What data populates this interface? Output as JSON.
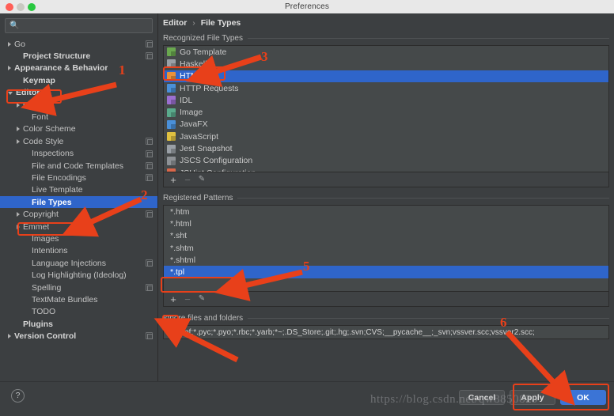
{
  "window": {
    "title": "Preferences",
    "traffic_lights": [
      "close-red",
      "minimize-yellow",
      "zoom-green"
    ]
  },
  "sidebar": {
    "search": {
      "value": "",
      "placeholder": "",
      "icon": "search-icon"
    },
    "items": [
      {
        "label": "Go",
        "arrow": "right",
        "indent": 0,
        "bold": false,
        "badge": true,
        "selected": false
      },
      {
        "label": "Project Structure",
        "arrow": "none",
        "indent": 1,
        "bold": true,
        "badge": true,
        "selected": false
      },
      {
        "label": "Appearance & Behavior",
        "arrow": "right",
        "indent": 0,
        "bold": true,
        "badge": false,
        "selected": false
      },
      {
        "label": "Keymap",
        "arrow": "none",
        "indent": 1,
        "bold": true,
        "badge": false,
        "selected": false
      },
      {
        "label": "Editor",
        "arrow": "down",
        "indent": 0,
        "bold": true,
        "badge": false,
        "selected": false
      },
      {
        "label": "General",
        "arrow": "right",
        "indent": 1,
        "bold": false,
        "badge": false,
        "selected": false
      },
      {
        "label": "Font",
        "arrow": "none",
        "indent": 2,
        "bold": false,
        "badge": false,
        "selected": false
      },
      {
        "label": "Color Scheme",
        "arrow": "right",
        "indent": 1,
        "bold": false,
        "badge": false,
        "selected": false
      },
      {
        "label": "Code Style",
        "arrow": "right",
        "indent": 1,
        "bold": false,
        "badge": true,
        "selected": false
      },
      {
        "label": "Inspections",
        "arrow": "none",
        "indent": 2,
        "bold": false,
        "badge": true,
        "selected": false
      },
      {
        "label": "File and Code Templates",
        "arrow": "none",
        "indent": 2,
        "bold": false,
        "badge": true,
        "selected": false
      },
      {
        "label": "File Encodings",
        "arrow": "none",
        "indent": 2,
        "bold": false,
        "badge": true,
        "selected": false
      },
      {
        "label": "Live Template",
        "arrow": "none",
        "indent": 2,
        "bold": false,
        "badge": false,
        "selected": false
      },
      {
        "label": "File Types",
        "arrow": "none",
        "indent": 2,
        "bold": true,
        "badge": false,
        "selected": true
      },
      {
        "label": "Copyright",
        "arrow": "right",
        "indent": 1,
        "bold": false,
        "badge": true,
        "selected": false
      },
      {
        "label": "Emmet",
        "arrow": "right",
        "indent": 1,
        "bold": false,
        "badge": false,
        "selected": false
      },
      {
        "label": "Images",
        "arrow": "none",
        "indent": 2,
        "bold": false,
        "badge": false,
        "selected": false
      },
      {
        "label": "Intentions",
        "arrow": "none",
        "indent": 2,
        "bold": false,
        "badge": false,
        "selected": false
      },
      {
        "label": "Language Injections",
        "arrow": "none",
        "indent": 2,
        "bold": false,
        "badge": true,
        "selected": false
      },
      {
        "label": "Log Highlighting (Ideolog)",
        "arrow": "none",
        "indent": 2,
        "bold": false,
        "badge": false,
        "selected": false
      },
      {
        "label": "Spelling",
        "arrow": "none",
        "indent": 2,
        "bold": false,
        "badge": true,
        "selected": false
      },
      {
        "label": "TextMate Bundles",
        "arrow": "none",
        "indent": 2,
        "bold": false,
        "badge": false,
        "selected": false
      },
      {
        "label": "TODO",
        "arrow": "none",
        "indent": 2,
        "bold": false,
        "badge": false,
        "selected": false
      },
      {
        "label": "Plugins",
        "arrow": "none",
        "indent": 1,
        "bold": true,
        "badge": false,
        "selected": false
      },
      {
        "label": "Version Control",
        "arrow": "right",
        "indent": 0,
        "bold": true,
        "badge": true,
        "selected": false
      }
    ]
  },
  "breadcrumb": {
    "parent": "Editor",
    "separator": "›",
    "current": "File Types"
  },
  "recognized": {
    "header": "Recognized File Types",
    "items": [
      {
        "label": "Go Template",
        "color": "#6aa84f",
        "selected": false
      },
      {
        "label": "Haskell",
        "color": "#9aa0a6",
        "selected": false
      },
      {
        "label": "HTML",
        "color": "#e8913a",
        "selected": true
      },
      {
        "label": "HTTP Requests",
        "color": "#4a90d9",
        "selected": false
      },
      {
        "label": "IDL",
        "color": "#9b6fd0",
        "selected": false
      },
      {
        "label": "Image",
        "color": "#5aab8c",
        "selected": false
      },
      {
        "label": "JavaFX",
        "color": "#4a90d9",
        "selected": false
      },
      {
        "label": "JavaScript",
        "color": "#e0c040",
        "selected": false
      },
      {
        "label": "Jest Snapshot",
        "color": "#9aa0a6",
        "selected": false
      },
      {
        "label": "JSCS Configuration",
        "color": "#8e9296",
        "selected": false
      },
      {
        "label": "JSHint Configuration",
        "color": "#d9674a",
        "selected": false
      }
    ],
    "toolbar": {
      "add": "+",
      "remove": "−",
      "edit": "edit-pencil-icon"
    }
  },
  "patterns": {
    "header": "Registered Patterns",
    "items": [
      {
        "label": "*.htm",
        "selected": false
      },
      {
        "label": "*.html",
        "selected": false
      },
      {
        "label": "*.sht",
        "selected": false
      },
      {
        "label": "*.shtm",
        "selected": false
      },
      {
        "label": "*.shtml",
        "selected": false
      },
      {
        "label": "*.tpl",
        "selected": true
      }
    ],
    "toolbar": {
      "add": "+",
      "remove": "−",
      "edit": "edit-pencil-icon"
    }
  },
  "ignore": {
    "label": "Ignore files and folders",
    "value": "*.hprof;*.pyc;*.pyo;*.rbc;*.yarb;*~;.DS_Store;.git;.hg;.svn;CVS;__pycache__;_svn;vssver.scc;vssver2.scc;"
  },
  "footer": {
    "help": "?",
    "cancel": "Cancel",
    "apply": "Apply",
    "ok": "OK"
  },
  "watermark": "https://blog.csdn.net/qw8850829",
  "annotations": [
    {
      "number": "1"
    },
    {
      "number": "2"
    },
    {
      "number": "3"
    },
    {
      "number": "5"
    },
    {
      "number": "6"
    }
  ],
  "colors": {
    "selection_blue": "#2f65ca",
    "annotation_red": "#e8401a",
    "panel_bg": "#3c3f41",
    "list_bg": "#45494a",
    "primary_button": "#3b74d6"
  }
}
